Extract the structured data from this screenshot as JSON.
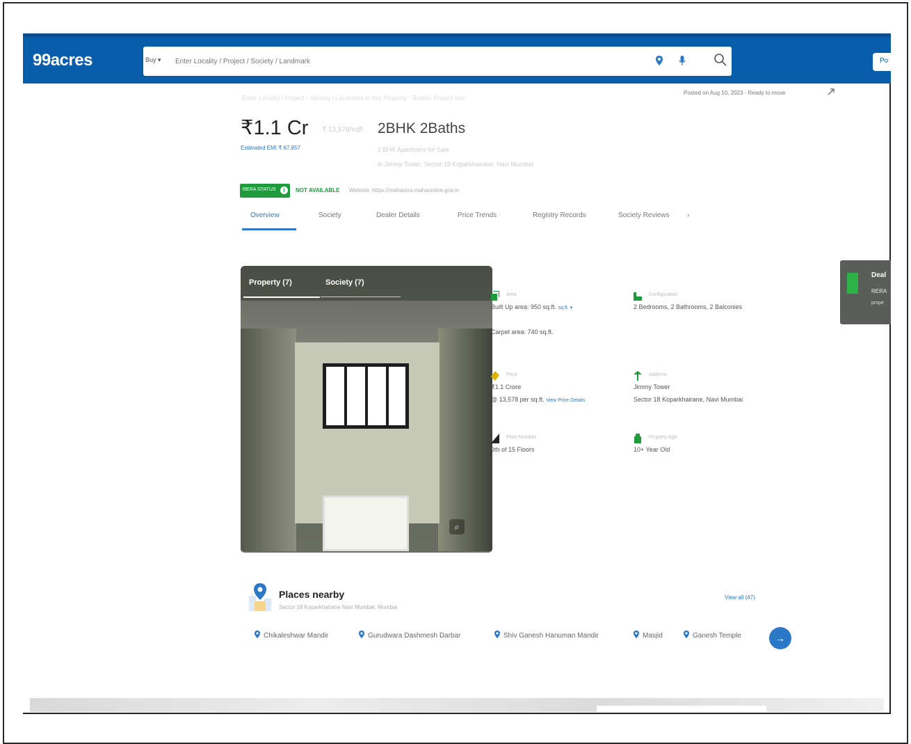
{
  "header": {
    "logo": "99acres",
    "buy_label": "Buy ▾",
    "search_placeholder": "Enter Locality / Project / Society / Landmark",
    "right_button": "Po"
  },
  "meta": {
    "faint_line": "Enter Locality / Project / Society / Landmark in this Property · Builder Project Info",
    "posted": "Posted on Aug 10, 2023 · Ready to move",
    "share_icon": "share-icon"
  },
  "listing": {
    "price": "₹1.1 Cr",
    "price_faint": "₹ 13,578/sqft",
    "emi": "Estimated EMI ₹ 67,857",
    "title": "2BHK 2Baths",
    "sub_faint_1": "2 BHK Apartment for Sale",
    "sub_faint_2": "in Jimmy Tower, Sector 18 Koparkhairane, Navi Mumbai",
    "rera_badge": "RERA STATUS",
    "rera_info": "i",
    "rera_status": "NOT AVAILABLE",
    "rera_note": "Website: https://maharera.mahaonline.gov.in"
  },
  "tabs": [
    {
      "label": "Overview"
    },
    {
      "label": "Society"
    },
    {
      "label": "Dealer Details"
    },
    {
      "label": "Price Trends"
    },
    {
      "label": "Registry Records"
    },
    {
      "label": "Society Reviews"
    }
  ],
  "tabs_more": "›",
  "gallery": {
    "tab_property": "Property (7)",
    "tab_society": "Society (7)",
    "zoom": "⌕"
  },
  "details": {
    "area_label": "Area",
    "area_line1": "Built Up area: 950 sq.ft.",
    "area_link": "sq.ft. ▾",
    "area_sublabel": "",
    "area_line2": "Carpet area: 740 sq.ft.",
    "config_label": "Configuration",
    "config_line": "2 Bedrooms, 2 Bathrooms, 2 Balconies",
    "price_label": "Price",
    "price_line1": "₹1.1 Crore",
    "price_line2": "@ 13,578 per sq.ft.",
    "price_link": "View Price Details",
    "address_label": "Address",
    "address_line1": "Jimmy Tower",
    "address_line2": "Sector 18 Koparkhairane, Navi Mumbai",
    "floor_label": "Floor Number",
    "floor_line": "9th of 15 Floors",
    "age_label": "Property Age",
    "age_line": "10+ Year Old"
  },
  "deal_card": {
    "title": "Deal",
    "line1": "RERA",
    "line2": "prope"
  },
  "places": {
    "title": "Places nearby",
    "subtitle": "Sector 18 Koparkhairane Navi Mumbai, Mumbai",
    "view_all": "View all (47)",
    "items": [
      {
        "label": "Chikaleshwar Mandir"
      },
      {
        "label": "Gurudwara Dashmesh Darbar"
      },
      {
        "label": "Shiv Ganesh Hanuman Mandir"
      },
      {
        "label": "Masjid"
      },
      {
        "label": "Ganesh Temple"
      }
    ],
    "next": "→"
  },
  "colors": {
    "header_blue": "#0a5dab",
    "link_blue": "#2b78c6",
    "rera_green": "#1f9a3c"
  }
}
